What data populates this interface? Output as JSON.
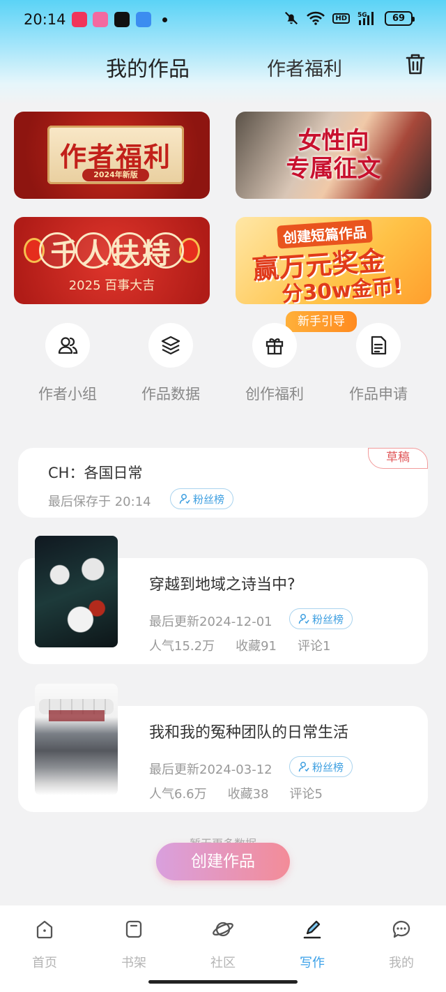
{
  "status_bar": {
    "time": "20:14",
    "battery": "69",
    "hd_label": "HD",
    "network": "5G"
  },
  "header": {
    "tab_works": "我的作品",
    "tab_welfare": "作者福利",
    "delete_icon": "trash-icon"
  },
  "banners": {
    "b1_title": "作者福利",
    "b1_sub": "2024年新版",
    "b2_line1": "女性向",
    "b2_line2": "专属征文",
    "b3_title": "千人扶持",
    "b3_sub": "2025 百事大吉",
    "b4_line1": "创建短篇作品",
    "b4_line2": "赢万元奖金",
    "b4_line3": "分30w金币!"
  },
  "guide_tag": "新手引导",
  "quick_actions": [
    {
      "label": "作者小组",
      "icon": "group-icon"
    },
    {
      "label": "作品数据",
      "icon": "layers-icon"
    },
    {
      "label": "创作福利",
      "icon": "gift-icon"
    },
    {
      "label": "作品申请",
      "icon": "document-icon"
    }
  ],
  "draft": {
    "title": "CH：各国日常",
    "saved": "最后保存于 20:14",
    "fan_label": "粉丝榜",
    "badge": "草稿"
  },
  "works": [
    {
      "title": "穿越到地域之诗当中?",
      "updated": "最后更新2024-12-01",
      "fan_label": "粉丝榜",
      "popularity": "人气15.2万",
      "favorites": "收藏91",
      "comments": "评论1"
    },
    {
      "title": "我和我的冤种团队的日常生活",
      "updated": "最后更新2024-03-12",
      "fan_label": "粉丝榜",
      "popularity": "人气6.6万",
      "favorites": "收藏38",
      "comments": "评论5"
    }
  ],
  "no_more": "暂无更多数据",
  "create_button": "创建作品",
  "bottom_nav": [
    {
      "label": "首页",
      "icon": "home-icon"
    },
    {
      "label": "书架",
      "icon": "bookshelf-icon"
    },
    {
      "label": "社区",
      "icon": "planet-icon"
    },
    {
      "label": "写作",
      "icon": "pen-icon",
      "active": true
    },
    {
      "label": "我的",
      "icon": "chat-bubble-icon"
    }
  ],
  "colors": {
    "accent": "#3aa0e8",
    "create_gradient_start": "#d9a0de",
    "create_gradient_end": "#f38c98",
    "draft_badge": "#e0585a"
  }
}
